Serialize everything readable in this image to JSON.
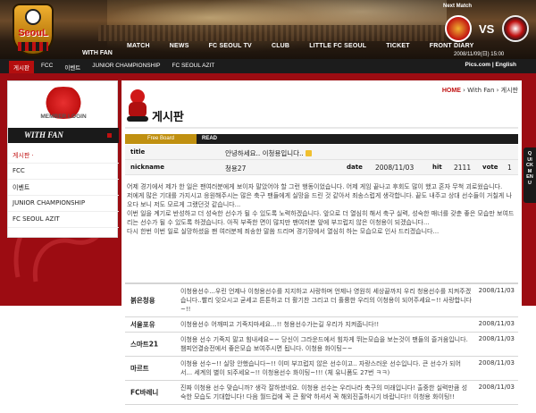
{
  "header": {
    "logo_text": "SeouL",
    "with_fan": "WITH FAN",
    "nav": [
      "MATCH",
      "NEWS",
      "FC SEOUL TV",
      "CLUB",
      "LITTLE FC SEOUL",
      "TICKET",
      "FRONT DIARY"
    ],
    "next_match_label": "Next Match",
    "vs": "VS",
    "match_date": "2008/11/09(日) 15:00"
  },
  "subnav": {
    "items": [
      "게시판",
      "FCC",
      "이벤트",
      "JUNIOR CHAMPIONSHIP",
      "FC SEOUL AZIT"
    ],
    "right": "Pics.com | English"
  },
  "sidebar": {
    "member_login": "MEMBER LOGIN",
    "section_title": "WITH FAN",
    "menu": [
      "게시판 ·",
      "FCC",
      "이벤트",
      "JUNIOR CHAMPIONSHIP",
      "FC SEOUL AZIT"
    ]
  },
  "breadcrumb": {
    "home": "HOME",
    "sep1": "›",
    "path1": "With Fan",
    "sep2": "›",
    "path2": "게시판"
  },
  "page_title": "게시판",
  "board": {
    "tab_free": "Free Board",
    "tab_read": "READ",
    "title_label": "title",
    "title_value": "안녕하세요.. 이청용입니다..",
    "nickname_label": "nickname",
    "nickname_value": "청용27",
    "date_label": "date",
    "date_value": "2008/11/03",
    "hit_label": "hit",
    "hit_value": "2111",
    "vote_label": "vote",
    "vote_value": "1"
  },
  "quick_menu": "QUICK MENU",
  "article": [
    "어제 경기에서 제가 한 일은 팬여러분에게 보이자 말았어야 할 그런 행동이었습니다. 어제 게임 끝나고 후회도 많이 했고 혼자 무척 괴로웠습니다.",
    "저에게 많은 기대를 가지시고 응원해주시는 많은 축구 팬들에게 실망을 드린 것 같아서 죄송스럽게 생각합니다. 끝도 내주고 상대 선수들이 거칠게 나오다 보니 저도 모르게 그랬던것 같습니다...",
    "이번 일을 계기로 반성하고 더 성숙한 선수가 될 수 있도록 노력하겠습니다. 앞으로 더 열심히 해서 축구 실력, 성숙한 매너를 갖춘 좋은 모습만 보여드리는 선수가 될 수 있도록 하겠습니다. 아직 부족한 면이 많지만 팬여러분 앞에 부끄럽지 않은 이청용이 되겠습니다...",
    "다시 한번 이번 일로 실망하셨을 팬 여러분께 죄송한 말씀 드리며 경기장에서 열심히 하는 모습으로 인사 드리겠습니다..."
  ],
  "comments": [
    {
      "author": "붉은청용",
      "text": "이청용선수...우린 언제나 이청용선수를 지지하고 사랑하며 언제나 영원히 세상끝까지 우리 청용선수를 지켜주겠습니다..빨리 잊으시고 굳세고 튼튼하고 더 활기찬 그리고 더 훌륭한 우리의 이청용이 되어주세요~!! 사랑합니다~!!",
      "date": "2008/11/03"
    },
    {
      "author": "서울포유",
      "text": "이청용선수 어깨피고 기죽지마세요...!! 청용선수가는길 우리가 지켜줍니다!!",
      "date": "2008/11/03"
    },
    {
      "author": "스마트21",
      "text": "이청용 선수 기죽지 말고 힘내세요~~ 당신이 그라운드에서 힘차게 뛰는모습을 보는것이 팬들의 즐거움입니다. 챔피언결승전에서 좋은모습 보여주시면 됩니다. 이청용 화이팅~~",
      "date": "2008/11/03"
    },
    {
      "author": "마르트",
      "text": "이청용 선수~!! 실망 안했습니다~!! 이미 부끄럽지 않은 선수이고.. 자랑스러운 선수입니다. 큰 선수가 되어서... 세계의 별이 되주세요~!! 이청용선수 화이팅~!!! (체 유니폼도 27번 ㅋㅋ)",
      "date": "2008/11/03"
    },
    {
      "author": "FC바레니",
      "text": "진짜 이청용 선수 맞습니까? 생각 잘하셨네요. 이청용 선수는 우리나라 축구의 미래입니다! 출중한 실력만큼 성숙한 모습도 기대합니다! 다음 월드컵에 꼭 큰 활약 하셔서 꼭 해외진출하시기 바랍니다!! 이청용 화이팅!!",
      "date": "2008/11/03"
    }
  ],
  "colors": {
    "brand_red": "#9c0c12",
    "accent_red": "#c01010",
    "gold": "#c09010",
    "dark": "#1c1c1c"
  }
}
